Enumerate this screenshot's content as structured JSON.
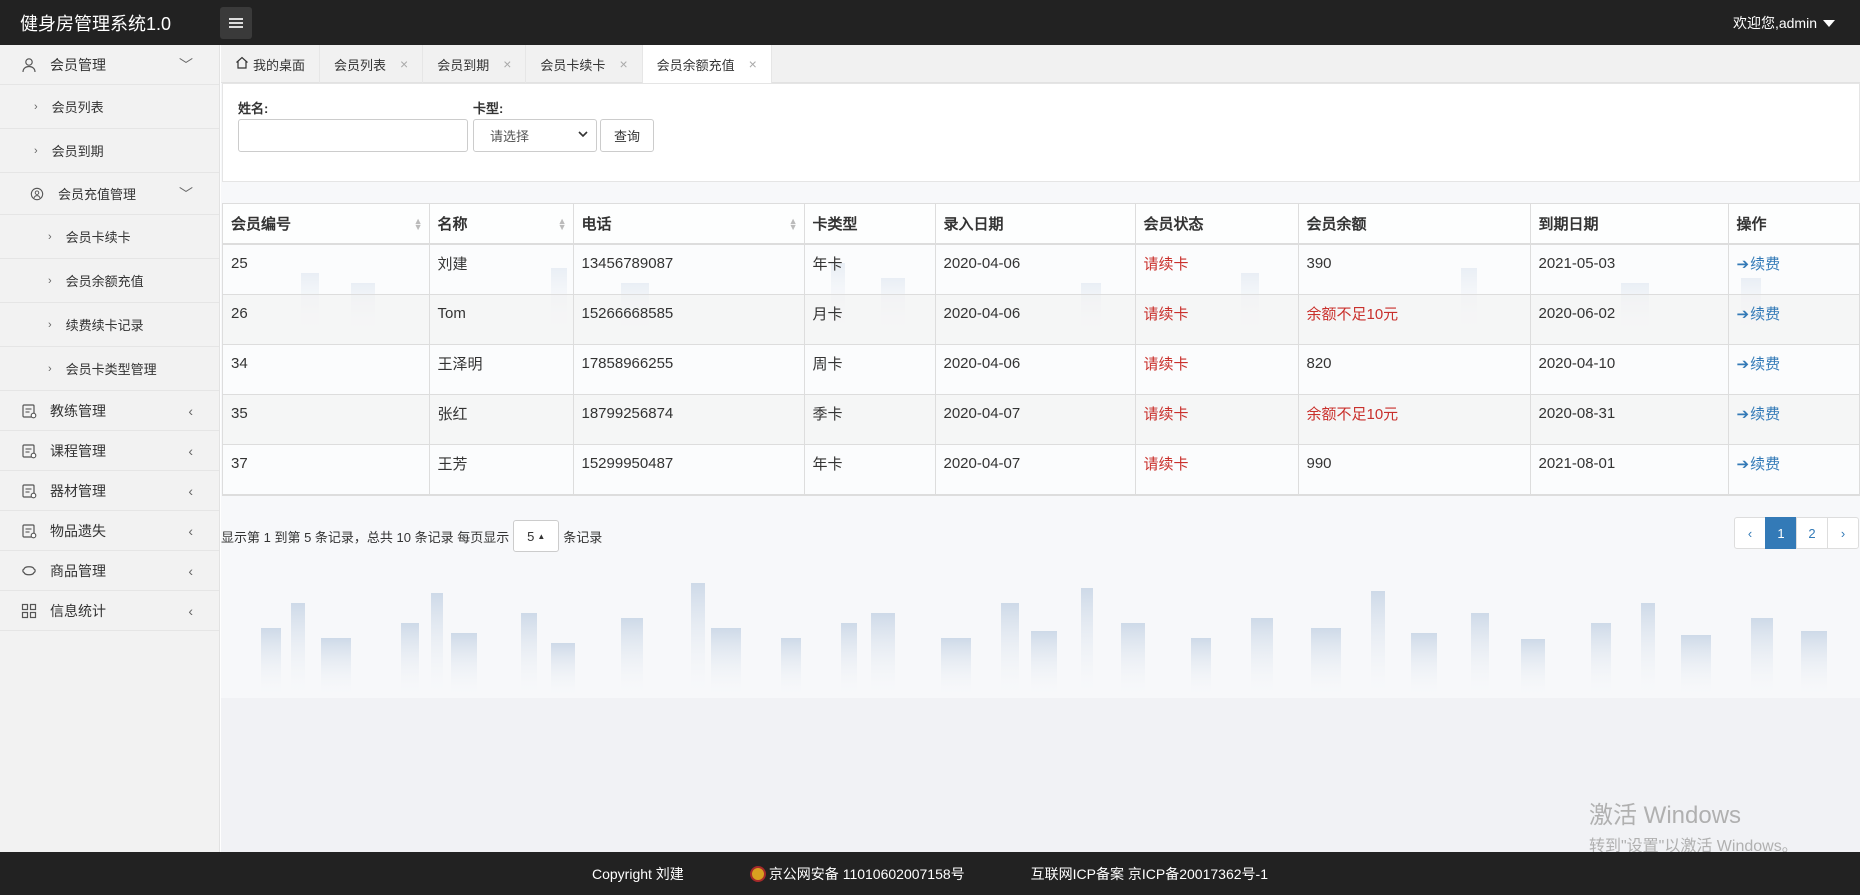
{
  "header": {
    "app_title": "健身房管理系统1.0",
    "user_greeting": "欢迎您,admin"
  },
  "sidebar": {
    "items": [
      {
        "label": "会员管理",
        "icon": "user-icon",
        "arrow": "﹀"
      },
      {
        "label": "会员列表"
      },
      {
        "label": "会员到期"
      },
      {
        "label": "会员充值管理",
        "icon": "user-circle-icon",
        "arrow": "﹀"
      },
      {
        "label": "会员卡续卡"
      },
      {
        "label": "会员余额充值"
      },
      {
        "label": "续费续卡记录"
      },
      {
        "label": "会员卡类型管理"
      },
      {
        "label": "教练管理",
        "icon": "coach-icon",
        "arrow": "‹"
      },
      {
        "label": "课程管理",
        "icon": "course-icon",
        "arrow": "‹"
      },
      {
        "label": "器材管理",
        "icon": "equipment-icon",
        "arrow": "‹"
      },
      {
        "label": "物品遗失",
        "icon": "lost-items-icon",
        "arrow": "‹"
      },
      {
        "label": "商品管理",
        "icon": "goods-icon",
        "arrow": "‹"
      },
      {
        "label": "信息统计",
        "icon": "grid-icon",
        "arrow": "‹"
      }
    ]
  },
  "tabs": [
    {
      "label": "我的桌面"
    },
    {
      "label": "会员列表"
    },
    {
      "label": "会员到期"
    },
    {
      "label": "会员卡续卡"
    },
    {
      "label": "会员余额充值"
    }
  ],
  "search": {
    "name_label": "姓名:",
    "name_value": "",
    "card_label": "卡型:",
    "card_selected": "请选择",
    "query_button": "查询"
  },
  "table": {
    "columns": [
      "会员编号",
      "名称",
      "电话",
      "卡类型",
      "录入日期",
      "会员状态",
      "会员余额",
      "到期日期",
      "操作"
    ],
    "rows": [
      {
        "id": "25",
        "name": "刘建",
        "phone": "13456789087",
        "card": "年卡",
        "date": "2020-04-06",
        "status": "请续卡",
        "balance": "390",
        "expire": "2021-05-03",
        "op": "续费"
      },
      {
        "id": "26",
        "name": "Tom",
        "phone": "15266668585",
        "card": "月卡",
        "date": "2020-04-06",
        "status": "请续卡",
        "balance": "余额不足10元",
        "expire": "2020-06-02",
        "op": "续费"
      },
      {
        "id": "34",
        "name": "王泽明",
        "phone": "17858966255",
        "card": "周卡",
        "date": "2020-04-06",
        "status": "请续卡",
        "balance": "820",
        "expire": "2020-04-10",
        "op": "续费"
      },
      {
        "id": "35",
        "name": "张红",
        "phone": "18799256874",
        "card": "季卡",
        "date": "2020-04-07",
        "status": "请续卡",
        "balance": "余额不足10元",
        "expire": "2020-08-31",
        "op": "续费"
      },
      {
        "id": "37",
        "name": "王芳",
        "phone": "15299950487",
        "card": "年卡",
        "date": "2020-04-07",
        "status": "请续卡",
        "balance": "990",
        "expire": "2021-08-01",
        "op": "续费"
      }
    ]
  },
  "pagination": {
    "info_prefix": "显示第 1 到第 5 条记录，总共 10 条记录 每页显示",
    "page_size": "5",
    "info_suffix": "条记录",
    "prev": "‹",
    "pages": [
      "1",
      "2"
    ],
    "next": "›",
    "current": "1"
  },
  "watermark": {
    "line1": "激活 Windows",
    "line2": "转到\"设置\"以激活 Windows。"
  },
  "footer": {
    "copyright": "Copyright 刘建",
    "police": "京公网安备 11010602007158号",
    "icp": "互联网ICP备案 京ICP备20017362号-1"
  },
  "colors": {
    "header_bg": "#222222",
    "accent": "#337ab7",
    "warning_red": "#c9302c"
  }
}
